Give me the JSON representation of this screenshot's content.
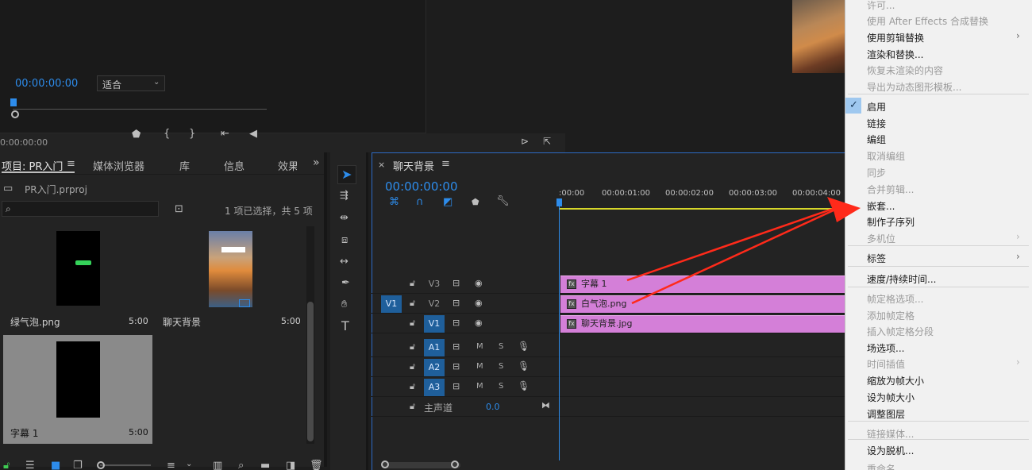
{
  "source_monitor": {
    "timecode": "0:00:00:00"
  },
  "program_monitor": {
    "timecode": "00:00:00:00",
    "fit_select": "适合"
  },
  "project_panel": {
    "tabs": [
      "项目: PR入门",
      "媒体浏览器",
      "库",
      "信息",
      "效果"
    ],
    "project_file": "PR入门.prproj",
    "selection_status": "1 项已选择，共 5 项",
    "items": [
      {
        "name": "绿气泡.png",
        "duration": "5:00"
      },
      {
        "name": "聊天背景",
        "duration": "5:00"
      },
      {
        "name": "字幕 1",
        "duration": "5:00"
      }
    ]
  },
  "timeline": {
    "sequence_name": "聊天背景",
    "timecode": "00:00:00:00",
    "ruler": [
      ":00:00",
      "00:00:01:00",
      "00:00:02:00",
      "00:00:03:00",
      "00:00:04:00"
    ],
    "video_tracks": [
      {
        "label": "V3",
        "source": "",
        "clip": "字幕 1"
      },
      {
        "label": "V2",
        "source": "V1",
        "clip": "白气泡.png"
      },
      {
        "label": "V1",
        "source": "",
        "clip": "聊天背景.jpg"
      }
    ],
    "audio_tracks": [
      {
        "label": "A1",
        "m": "M",
        "s": "S"
      },
      {
        "label": "A2",
        "m": "M",
        "s": "S"
      },
      {
        "label": "A3",
        "m": "M",
        "s": "S"
      }
    ],
    "master": {
      "label": "主声道",
      "value": "0.0"
    },
    "fx_badge": "fx"
  },
  "context_menu": {
    "items": [
      {
        "label": "许可...",
        "enabled": false,
        "submenu": false
      },
      {
        "label": "使用 After Effects 合成替换",
        "enabled": false,
        "submenu": false
      },
      {
        "label": "使用剪辑替换",
        "enabled": true,
        "submenu": true
      },
      {
        "label": "渲染和替换...",
        "enabled": true,
        "submenu": false
      },
      {
        "label": "恢复未渲染的内容",
        "enabled": false,
        "submenu": false
      },
      {
        "label": "导出为动态图形模板...",
        "enabled": false,
        "submenu": false
      },
      {
        "label": "启用",
        "enabled": true,
        "submenu": false,
        "checked": true
      },
      {
        "label": "链接",
        "enabled": true,
        "submenu": false
      },
      {
        "label": "编组",
        "enabled": true,
        "submenu": false
      },
      {
        "label": "取消编组",
        "enabled": false,
        "submenu": false
      },
      {
        "label": "同步",
        "enabled": false,
        "submenu": false
      },
      {
        "label": "合并剪辑...",
        "enabled": false,
        "submenu": false
      },
      {
        "label": "嵌套...",
        "enabled": true,
        "submenu": false
      },
      {
        "label": "制作子序列",
        "enabled": true,
        "submenu": false
      },
      {
        "label": "多机位",
        "enabled": false,
        "submenu": true
      },
      {
        "label": "标签",
        "enabled": true,
        "submenu": true
      },
      {
        "label": "速度/持续时间...",
        "enabled": true,
        "submenu": false
      },
      {
        "label": "帧定格选项...",
        "enabled": false,
        "submenu": false
      },
      {
        "label": "添加帧定格",
        "enabled": false,
        "submenu": false
      },
      {
        "label": "插入帧定格分段",
        "enabled": false,
        "submenu": false
      },
      {
        "label": "场选项...",
        "enabled": true,
        "submenu": false
      },
      {
        "label": "时间插值",
        "enabled": false,
        "submenu": true
      },
      {
        "label": "缩放为帧大小",
        "enabled": true,
        "submenu": false
      },
      {
        "label": "设为帧大小",
        "enabled": true,
        "submenu": false
      },
      {
        "label": "调整图层",
        "enabled": true,
        "submenu": false
      },
      {
        "label": "链接媒体...",
        "enabled": false,
        "submenu": false
      },
      {
        "label": "设为脱机...",
        "enabled": true,
        "submenu": false
      },
      {
        "label": "重命名...",
        "enabled": false,
        "submenu": false
      }
    ],
    "checkmark": "✓",
    "submenu_arrow": "›"
  },
  "colors": {
    "accent_blue": "#2d8ceb",
    "clip_pink": "#d47fd8",
    "annotation_red": "#ff2a1a"
  }
}
